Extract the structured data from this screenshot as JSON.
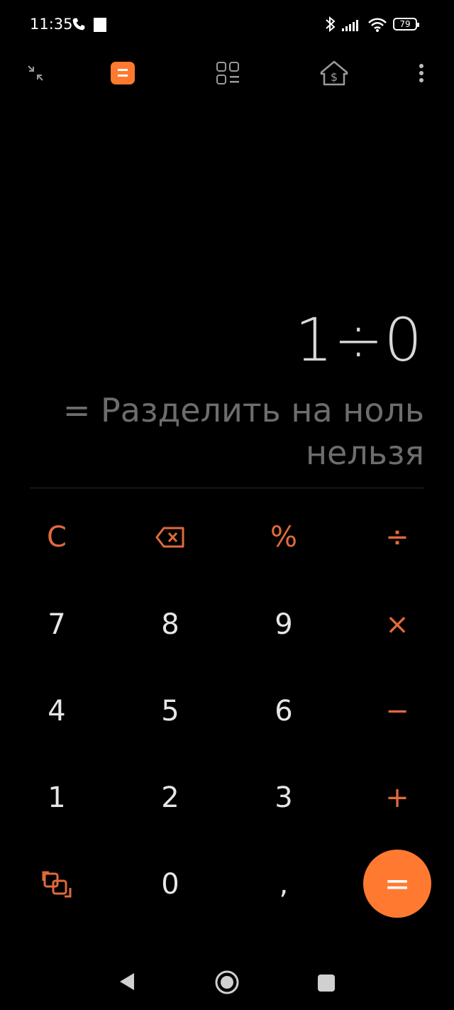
{
  "status_bar": {
    "time": "11:35",
    "battery": "79"
  },
  "display": {
    "expression": "1÷0",
    "result": "= Разделить на ноль нельзя"
  },
  "keys": {
    "clear": "C",
    "percent": "%",
    "divide": "÷",
    "multiply": "×",
    "minus": "−",
    "plus": "+",
    "equals": "=",
    "comma": ",",
    "d7": "7",
    "d8": "8",
    "d9": "9",
    "d4": "4",
    "d5": "5",
    "d6": "6",
    "d1": "1",
    "d2": "2",
    "d3": "3",
    "d0": "0"
  },
  "colors": {
    "accent": "#ff7a30",
    "operator": "#e06a3c",
    "background": "#000000"
  }
}
